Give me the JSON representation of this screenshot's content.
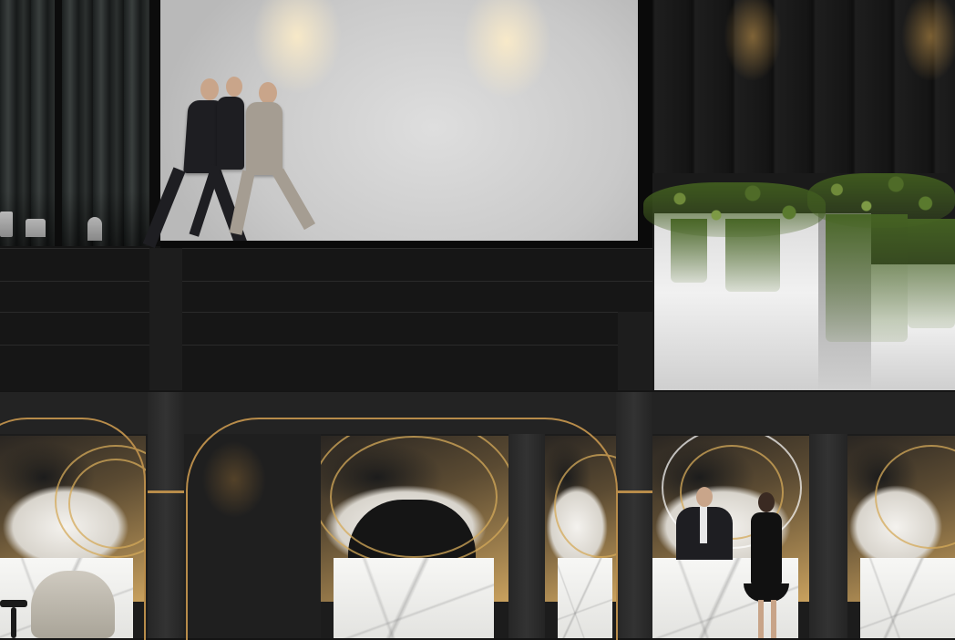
{
  "scene": {
    "colors": {
      "facade_black": "#141414",
      "gallery_wall": "#d2d2d2",
      "gold_trim": "#b88c4a",
      "foliage_green": "#5a7a2e",
      "marble_white": "#f1f1ef"
    },
    "elements": {
      "upper_level": [
        "curtain-panel",
        "gallery-window",
        "walking-businessmen",
        "upper-right-panels",
        "hanging-planters"
      ],
      "lower_level": [
        "gold-arch-frames",
        "topographic-art-panels",
        "marble-counters",
        "reception-staff",
        "lounge-chair"
      ]
    }
  }
}
